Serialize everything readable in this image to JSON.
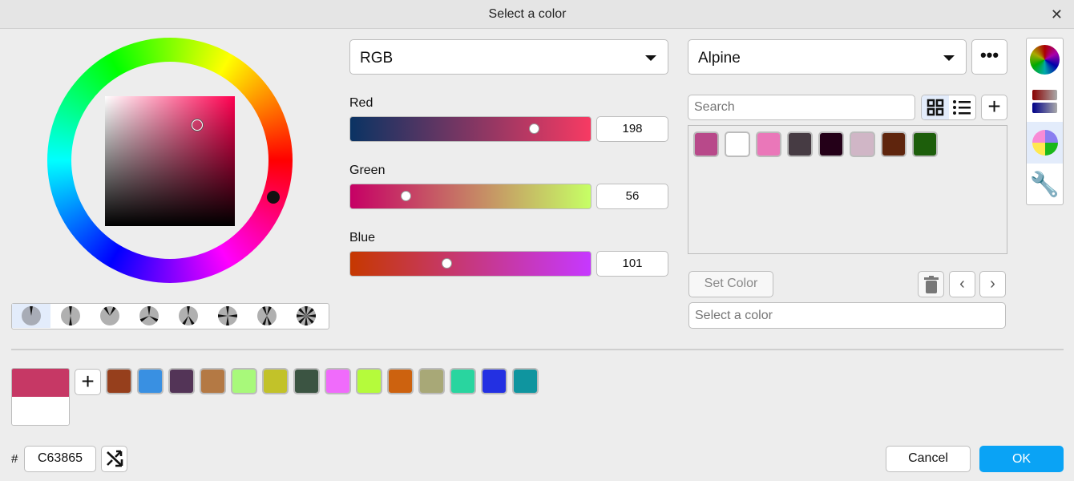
{
  "dialog": {
    "title": "Select a color",
    "close_icon": "close-icon"
  },
  "picker": {
    "hue_marker_angle_deg": -15,
    "sv_marker": {
      "saturation": 0.72,
      "value": 0.78
    }
  },
  "harmony_modes": [
    "single",
    "complementary",
    "analogous",
    "triad",
    "split-complementary",
    "square",
    "tetradic",
    "hexad"
  ],
  "harmony_selected": 0,
  "model": {
    "selected": "RGB"
  },
  "channels": [
    {
      "label": "Red",
      "value": "198",
      "fraction": 0.776,
      "gradient": [
        "#0a3363",
        "#f73a63"
      ]
    },
    {
      "label": "Green",
      "value": "56",
      "fraction": 0.22,
      "gradient": [
        "#c60065",
        "#c6ff65"
      ]
    },
    {
      "label": "Blue",
      "value": "101",
      "fraction": 0.396,
      "gradient": [
        "#c63800",
        "#c638ff"
      ]
    }
  ],
  "palette": {
    "selected": "Alpine",
    "search_placeholder": "Search",
    "swatches": [
      "#b8498a",
      "#ffffff",
      "#ea77b9",
      "#463b43",
      "#240018",
      "#d0b6c6",
      "#5f250d",
      "#1d5e0b"
    ],
    "set_color_label": "Set Color",
    "name_placeholder": "Select a color"
  },
  "sidebar": [
    "color-wheel-icon",
    "sliders-icon",
    "harmony-wheel-icon",
    "wrench-icon"
  ],
  "sidebar_selected": 2,
  "current": {
    "new": "#c63865",
    "old": "#ffffff",
    "hex_prefix": "#",
    "hex": "C63865"
  },
  "recent": [
    "#963f1c",
    "#3990e2",
    "#533457",
    "#b47944",
    "#a8f97a",
    "#c2c229",
    "#3b5442",
    "#f06bfb",
    "#b5fb3b",
    "#cd620f",
    "#a8a877",
    "#29d59f",
    "#2330e2",
    "#0f959f"
  ],
  "footer": {
    "cancel": "Cancel",
    "ok": "OK"
  },
  "colors": {
    "accent": "#0aa3f5",
    "selection": "#e3ecfb"
  }
}
